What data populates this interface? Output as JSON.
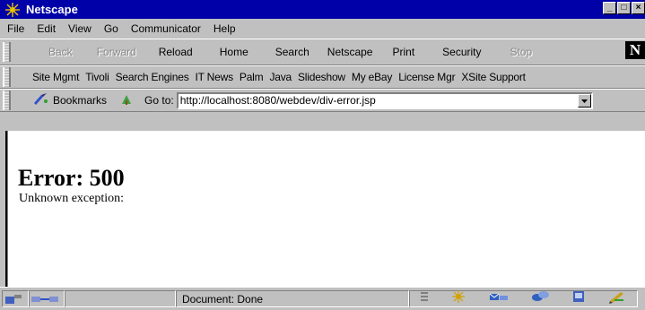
{
  "window": {
    "title": "Netscape"
  },
  "menu": [
    "File",
    "Edit",
    "View",
    "Go",
    "Communicator",
    "Help"
  ],
  "nav_toolbar": {
    "buttons": [
      {
        "label": "Back",
        "enabled": false
      },
      {
        "label": "Forward",
        "enabled": false
      },
      {
        "label": "Reload",
        "enabled": true
      },
      {
        "label": "Home",
        "enabled": true
      },
      {
        "label": "Search",
        "enabled": true
      },
      {
        "label": "Netscape",
        "enabled": true
      },
      {
        "label": "Print",
        "enabled": true
      },
      {
        "label": "Security",
        "enabled": true
      },
      {
        "label": "Stop",
        "enabled": false
      }
    ]
  },
  "personal_toolbar": {
    "links": [
      "Site Mgmt",
      "Tivoli",
      "Search Engines",
      "IT News",
      "Palm",
      "Java",
      "Slideshow",
      "My eBay",
      "License Mgr",
      "XSite Support"
    ]
  },
  "location_toolbar": {
    "bookmarks_label": "Bookmarks",
    "goto_label": "Go to:",
    "url": "http://localhost:8080/webdev/div-error.jsp"
  },
  "page": {
    "heading": "Error: 500",
    "message": "Unknown exception:"
  },
  "status": {
    "text": "Document: Done"
  },
  "colors": {
    "titlebar": "#0000a8",
    "chrome": "#c0c0c0"
  }
}
